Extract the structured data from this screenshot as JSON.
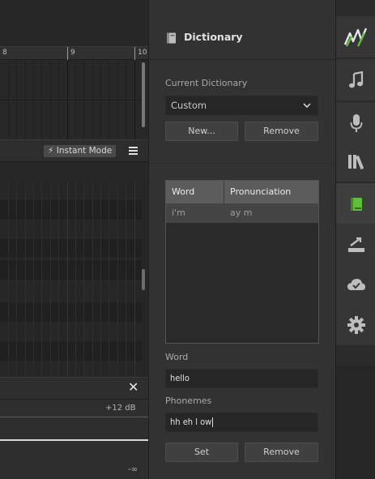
{
  "timeline": {
    "ruler_marks": [
      "8",
      "9",
      "10"
    ]
  },
  "toolbar": {
    "instant_mode_label": "Instant Mode",
    "instant_mode_icon": "lightning-icon",
    "menu_icon": "hamburger-menu-icon"
  },
  "mixer": {
    "db_top_label": "+12 dB",
    "db_bottom_label": "-∞"
  },
  "dictionary": {
    "title": "Dictionary",
    "current_dictionary_label": "Current Dictionary",
    "selected_dictionary": "Custom",
    "new_button": "New...",
    "remove_button": "Remove",
    "table": {
      "columns": [
        "Word",
        "Pronunciation"
      ],
      "rows": [
        {
          "word": "i'm",
          "pronunciation": "ay m"
        }
      ]
    },
    "word_label": "Word",
    "word_value": "hello",
    "phonemes_label": "Phonemes",
    "phonemes_value": "hh eh l ow",
    "set_button": "Set",
    "remove_bottom_button": "Remove"
  },
  "rail": {
    "items": [
      {
        "icon": "app-logo-icon",
        "active": false
      },
      {
        "icon": "music-note-icon",
        "active": false
      },
      {
        "icon": "microphone-icon",
        "active": false
      },
      {
        "icon": "library-icon",
        "active": false
      },
      {
        "icon": "dictionary-book-icon",
        "active": true,
        "color": "#5fbf3a"
      },
      {
        "icon": "render-export-icon",
        "active": false
      },
      {
        "icon": "cloud-check-icon",
        "active": false
      },
      {
        "icon": "settings-gear-icon",
        "active": false
      }
    ]
  },
  "colors": {
    "accent_green": "#5fbf3a",
    "panel_bg": "#323232",
    "table_header_bg": "#5c5c5c"
  }
}
